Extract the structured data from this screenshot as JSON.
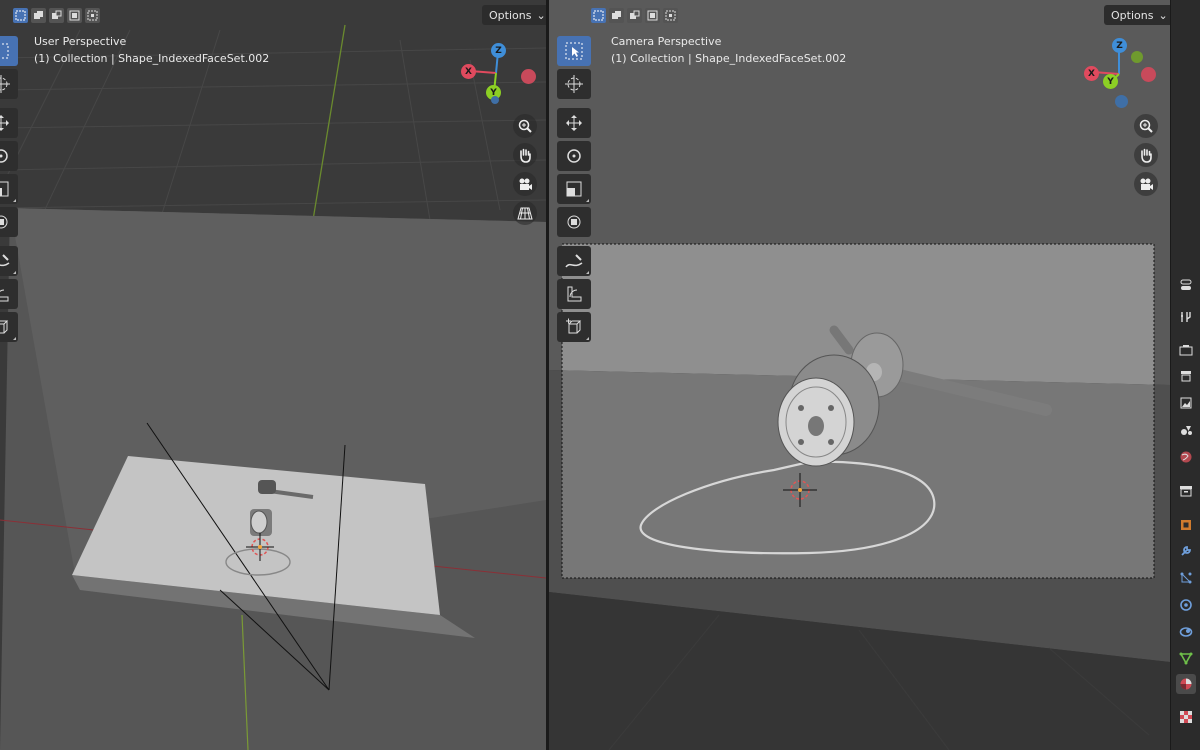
{
  "left_viewport": {
    "view_name": "User Perspective",
    "collection_info": "(1) Collection | Shape_IndexedFaceSet.002",
    "options_label": "Options"
  },
  "right_viewport": {
    "view_name": "Camera Perspective",
    "collection_info": "(1) Collection | Shape_IndexedFaceSet.002",
    "options_label": "Options"
  },
  "gizmo": {
    "x_label": "X",
    "y_label": "Y",
    "z_label": "Z"
  },
  "header_modes": [
    "select-new-icon",
    "select-extend-icon",
    "select-subtract-icon",
    "select-invert-icon",
    "select-intersect-icon"
  ],
  "toolbar_tools": [
    "select-box-icon",
    "cursor-icon",
    "move-icon",
    "rotate-icon",
    "scale-icon",
    "transform-icon",
    "annotate-icon",
    "measure-icon",
    "add-cube-icon"
  ],
  "nav_buttons": [
    "zoom-icon",
    "pan-hand-icon",
    "camera-view-icon",
    "perspective-grid-icon"
  ],
  "properties_tabs": [
    "tool-icon",
    "render-icon",
    "output-icon",
    "view-layer-icon",
    "scene-icon",
    "world-icon",
    "collection-icon",
    "object-icon",
    "modifier-icon",
    "particles-icon",
    "physics-icon",
    "constraints-icon",
    "data-icon",
    "material-icon",
    "texture-icon"
  ],
  "colors": {
    "accent": "#4772b3",
    "x_axis": "#e04a5e",
    "y_axis": "#8ccf24",
    "z_axis": "#3f8ed8"
  }
}
